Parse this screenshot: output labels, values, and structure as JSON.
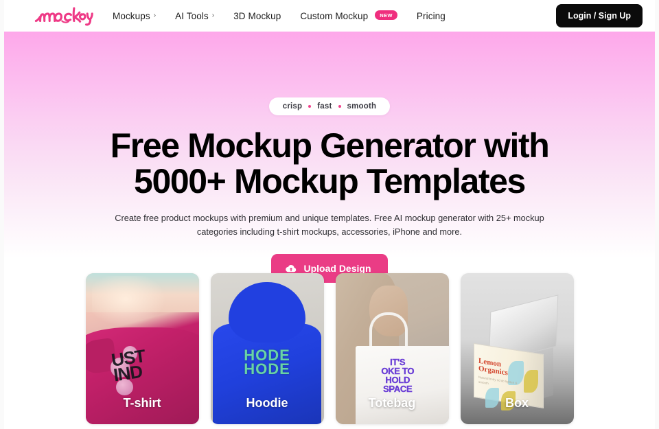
{
  "brand": {
    "logo_text": "mockey",
    "logo_color": "#ee3a86"
  },
  "navbar": {
    "items": [
      {
        "label": "Mockups",
        "has_chevron": true,
        "chevron": "›",
        "badge": null
      },
      {
        "label": "AI Tools",
        "has_chevron": true,
        "chevron": "›",
        "badge": null
      },
      {
        "label": "3D Mockup",
        "has_chevron": false,
        "chevron": "",
        "badge": null
      },
      {
        "label": "Custom Mockup",
        "has_chevron": false,
        "chevron": "",
        "badge": "NEW"
      },
      {
        "label": "Pricing",
        "has_chevron": false,
        "chevron": "",
        "badge": null
      }
    ],
    "login_label": "Login / Sign Up",
    "login_bg": "#0b0b0b"
  },
  "hero": {
    "pill": {
      "words": [
        "crisp",
        "fast",
        "smooth"
      ],
      "dot_color": "#f0408a"
    },
    "headline_line1": "Free Mockup Generator with",
    "headline_line2": "5000+ Mockup Templates",
    "subtitle": "Create free product mockups with premium and unique templates. Free AI mockup generator with 25+ mockup categories including t-shirt mockups, accessories, iPhone and more.",
    "cta_label": "Upload Design",
    "cta_icon": "cloud-upload-icon",
    "cta_bg": "#ea3c85",
    "gradient_top": "#fda8ea",
    "gradient_bottom": "#ffffff"
  },
  "cards": [
    {
      "label": "T-shirt",
      "art": "pink-tshirt-photo",
      "graphic_text_line1": "UST",
      "graphic_text_line2": "IND"
    },
    {
      "label": "Hoodie",
      "art": "blue-hoodie-photo",
      "graphic_text_line1": "HODE",
      "graphic_text_line2": "HODE"
    },
    {
      "label": "Totebag",
      "art": "white-totebag-photo",
      "graphic_text_line1": "IT'S",
      "graphic_text_line2": "OKE TO",
      "graphic_text_line3": "HOLD",
      "graphic_text_line4": "SPACE"
    },
    {
      "label": "Box",
      "art": "open-product-box-photo",
      "box_brand_line1": "Lemon",
      "box_brand_line2": "Organics",
      "box_sub": "Natural body scrub\nlighten & smooth"
    }
  ]
}
